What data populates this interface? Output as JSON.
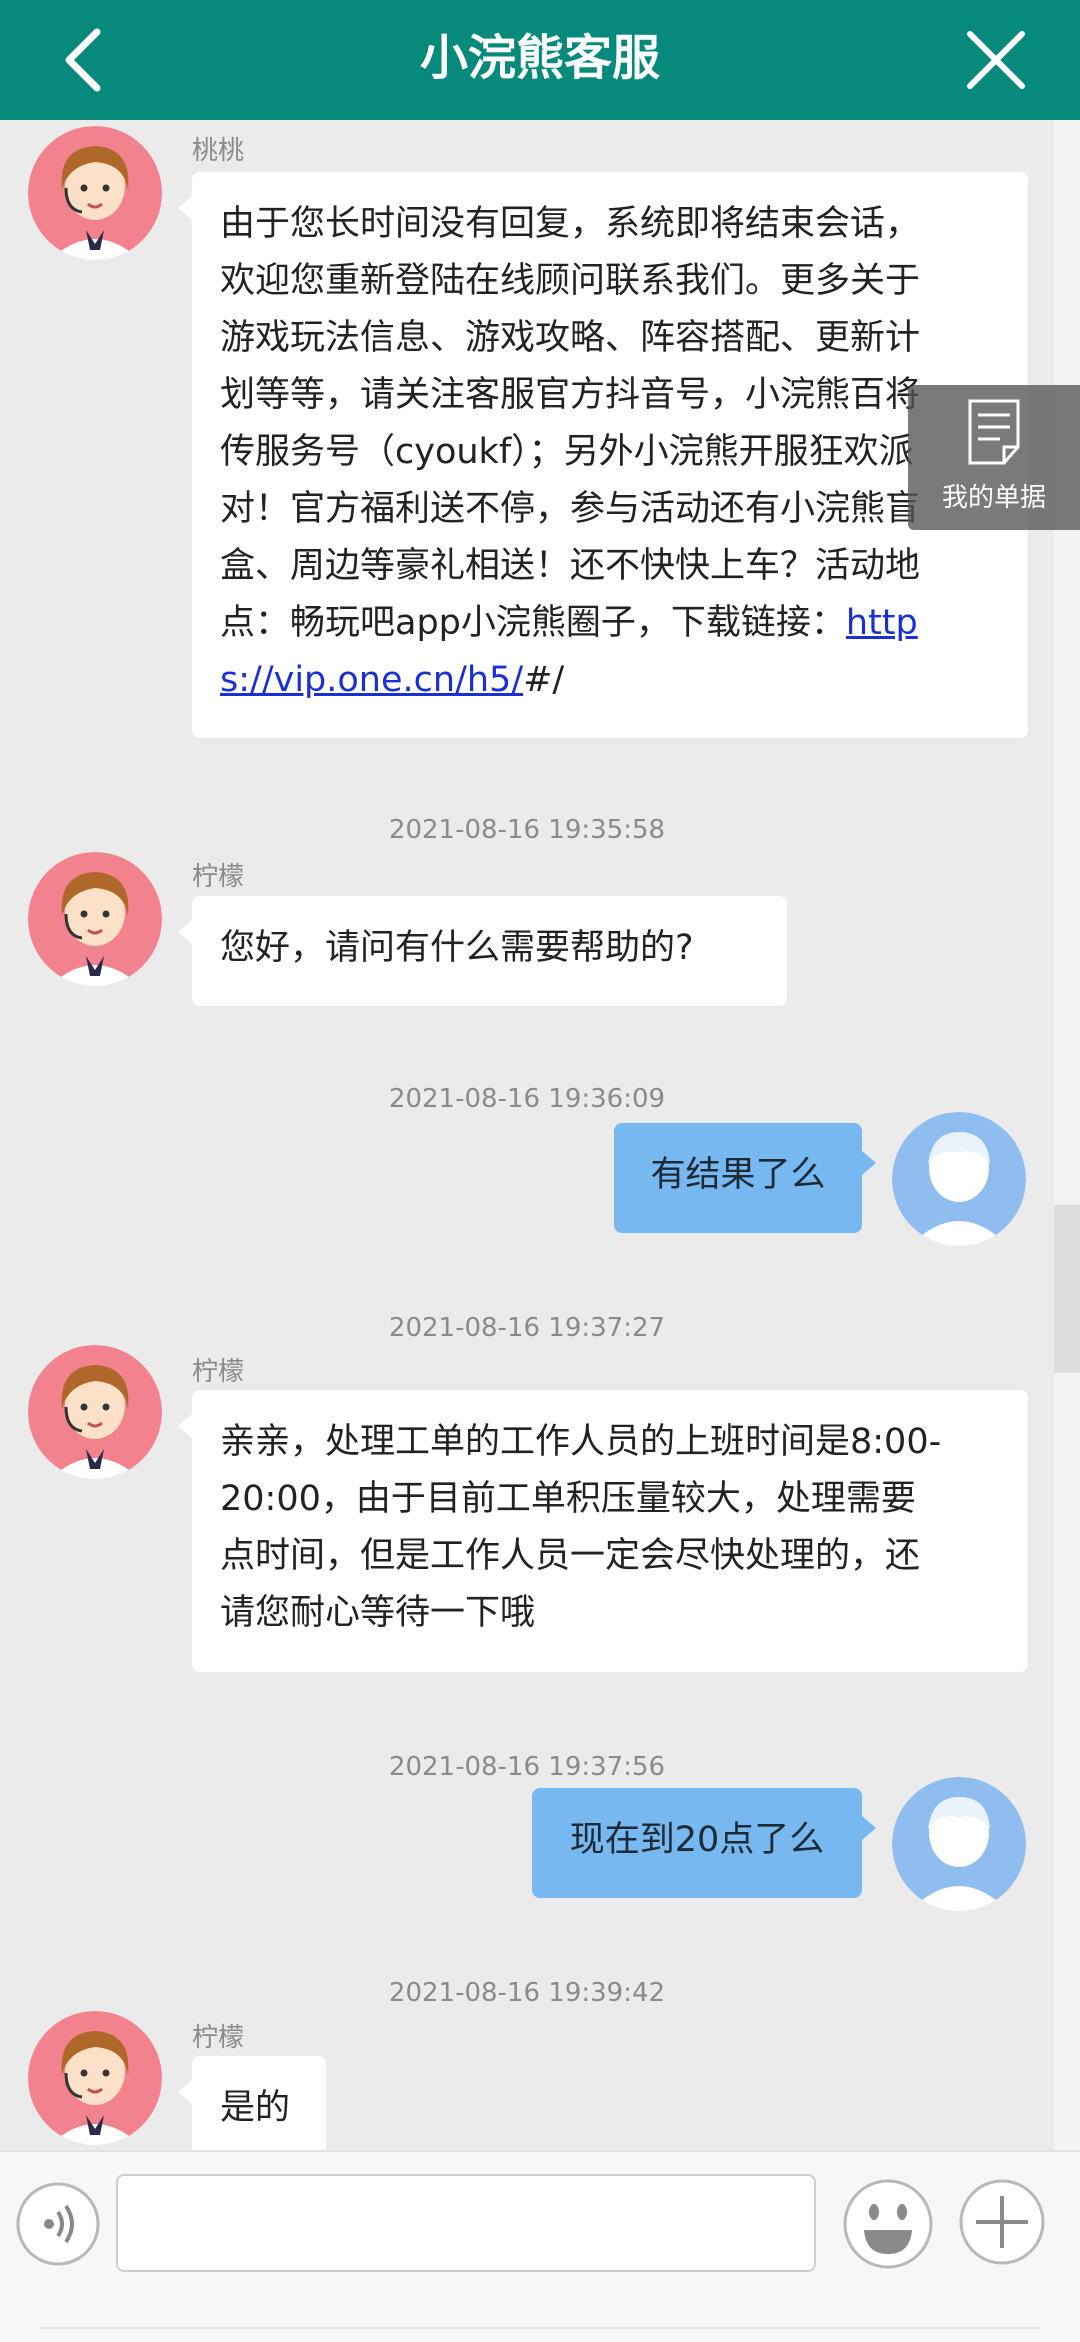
{
  "header": {
    "title": "小浣熊客服",
    "back_icon": "chevron-left-icon",
    "close_icon": "close-icon",
    "background": "#078a7c"
  },
  "floating_tickets": {
    "label": "我的单据",
    "icon": "document-icon"
  },
  "messages": [
    {
      "sender": "桃桃",
      "role": "agent",
      "lines": [
        "由于您长时间没有回复，系统即将结束会话，",
        "欢迎您重新登陆在线顾问联系我们。更多关于",
        "游戏玩法信息、游戏攻略、阵容搭配、更新计",
        "划等等，请关注客服官方抖音号，小浣熊百将",
        "传服务号（cyoukf）；另外小浣熊开服狂欢派",
        "对！官方福利送不停，参与活动还有小浣熊盲",
        "盒、周边等豪礼相送！还不快快上车？活动地",
        "点：畅玩吧app小浣熊圈子，下载链接："
      ],
      "link_part1": "http",
      "link_part2": "s://vip.one.cn/h5/",
      "link_suffix": "#/"
    },
    {
      "time": "2021-08-16 19:35:58",
      "sender": "柠檬",
      "role": "agent",
      "text": "您好，请问有什么需要帮助的?"
    },
    {
      "time": "2021-08-16 19:36:09",
      "role": "user",
      "text": "有结果了么"
    },
    {
      "time": "2021-08-16 19:37:27",
      "sender": "柠檬",
      "role": "agent",
      "lines": [
        "亲亲，处理工单的工作人员的上班时间是8:00-",
        "20:00，由于目前工单积压量较大，处理需要",
        "点时间，但是工作人员一定会尽快处理的，还",
        "请您耐心等待一下哦"
      ]
    },
    {
      "time": "2021-08-16 19:37:56",
      "role": "user",
      "text": "现在到20点了么"
    },
    {
      "time": "2021-08-16 19:39:42",
      "sender": "柠檬",
      "role": "agent",
      "text": "是的"
    }
  ],
  "composer": {
    "input_value": "",
    "voice_icon": "voice-icon",
    "emoji_icon": "emoji-icon",
    "plus_icon": "plus-icon"
  },
  "colors": {
    "agent_bubble": "#ffffff",
    "user_bubble": "#76b8ef",
    "background": "#ebebeb"
  }
}
